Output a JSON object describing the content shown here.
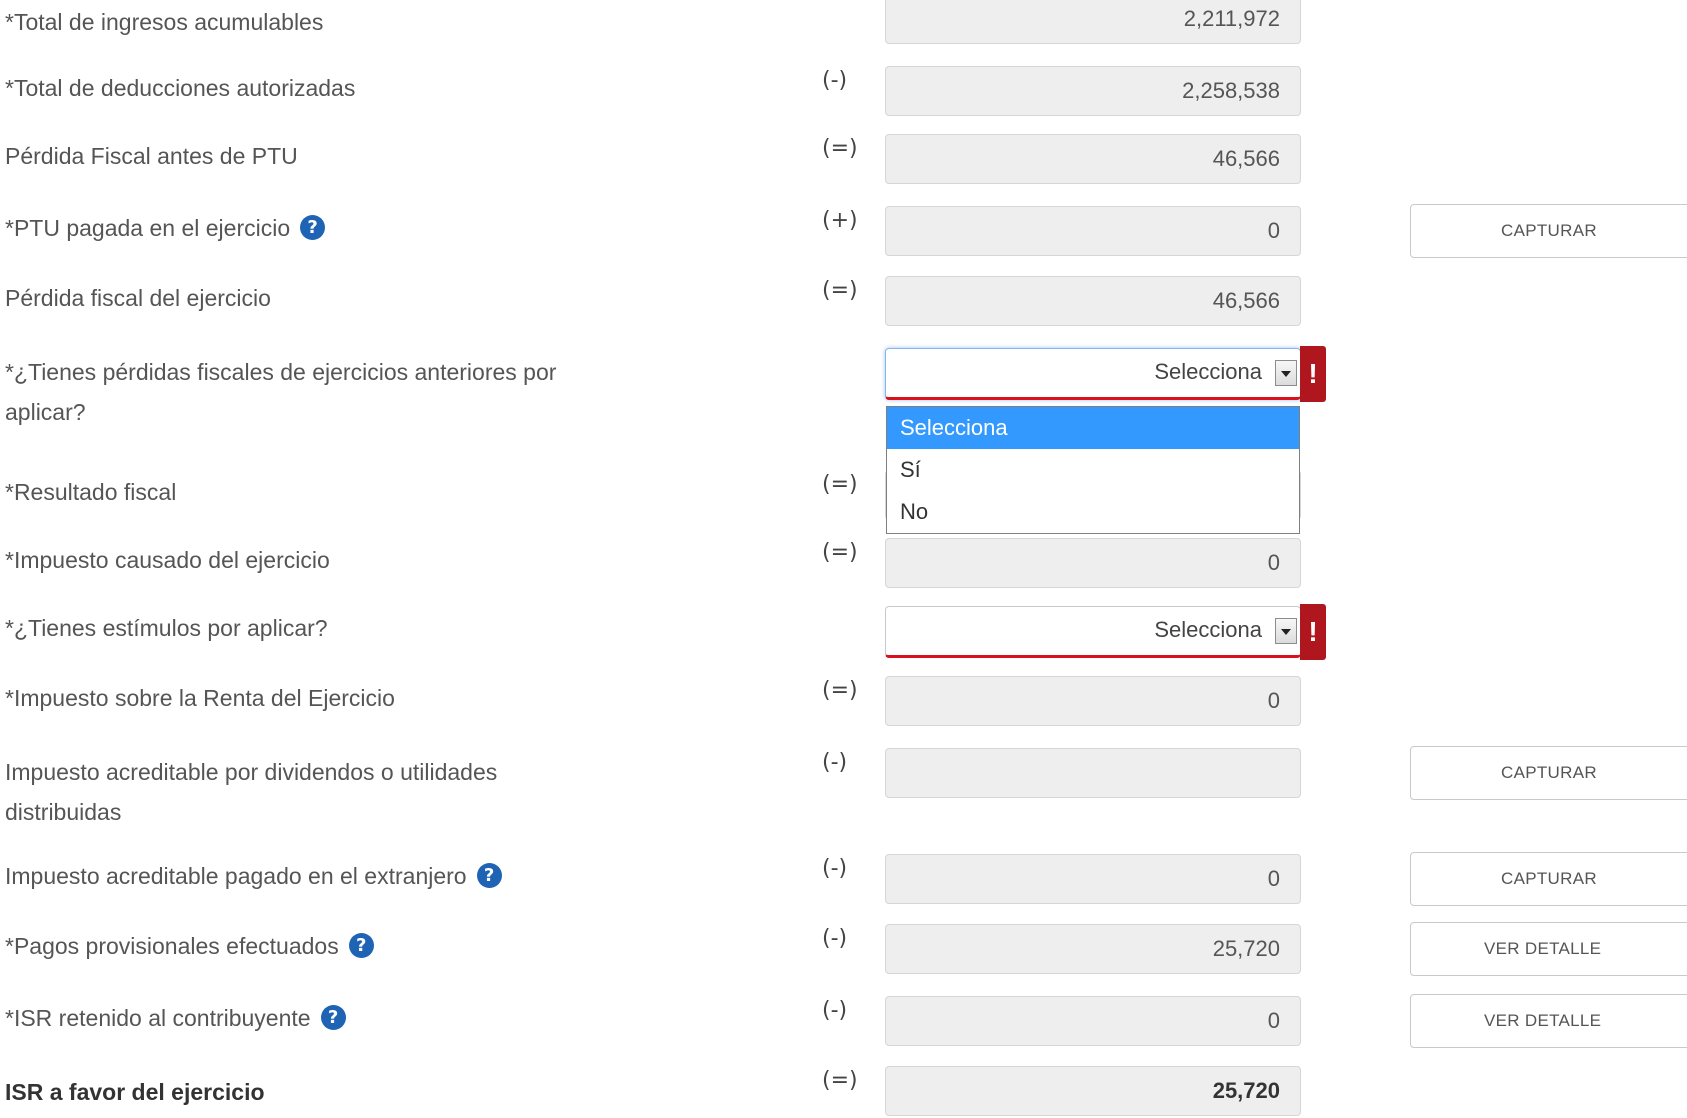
{
  "rows": [
    {
      "label": "*Total de ingresos acumulables",
      "operator": "",
      "value": "2,211,972"
    },
    {
      "label": "*Total de deducciones autorizadas",
      "operator": "(-)",
      "value": "2,258,538"
    },
    {
      "label": "Pérdida Fiscal antes de PTU",
      "operator": "(=)",
      "value": "46,566"
    },
    {
      "label": "*PTU pagada en el ejercicio",
      "operator": "(+)",
      "value": "0",
      "button": "CAPTURAR"
    },
    {
      "label": "Pérdida fiscal del ejercicio",
      "operator": "(=)",
      "value": "46,566"
    },
    {
      "label_line1": "*¿Tienes pérdidas fiscales de ejercicios anteriores por",
      "label_line2": "aplicar?",
      "select_value": "Selecciona",
      "error": "!"
    },
    {
      "label": "*Resultado fiscal",
      "operator": "(=)",
      "value": ""
    },
    {
      "label": "*Impuesto causado del ejercicio",
      "operator": "(=)",
      "value": "0"
    },
    {
      "label": "*¿Tienes estímulos por aplicar?",
      "select_value": "Selecciona",
      "error": "!"
    },
    {
      "label": "*Impuesto sobre la Renta del Ejercicio",
      "operator": "(=)",
      "value": "0"
    },
    {
      "label_line1": "Impuesto acreditable por dividendos o utilidades",
      "label_line2": "distribuidas",
      "operator": "(-)",
      "value": "",
      "button": "CAPTURAR"
    },
    {
      "label": "Impuesto acreditable pagado en el extranjero",
      "operator": "(-)",
      "value": "0",
      "button": "CAPTURAR"
    },
    {
      "label": "*Pagos provisionales efectuados",
      "operator": "(-)",
      "value": "25,720",
      "button": "VER DETALLE"
    },
    {
      "label": "*ISR retenido al contribuyente",
      "operator": "(-)",
      "value": "0",
      "button": "VER DETALLE"
    },
    {
      "label": "ISR a favor del ejercicio",
      "operator": "(=)",
      "value": "25,720"
    }
  ],
  "dropdown": {
    "options": [
      "Selecciona",
      "Sí",
      "No"
    ],
    "highlighted": "Selecciona"
  },
  "help_icon_glyph": "?",
  "colors": {
    "help_icon": "#1e63b4",
    "error": "#b0161e",
    "error_border": "#d9111c",
    "highlight": "#3399ff"
  }
}
